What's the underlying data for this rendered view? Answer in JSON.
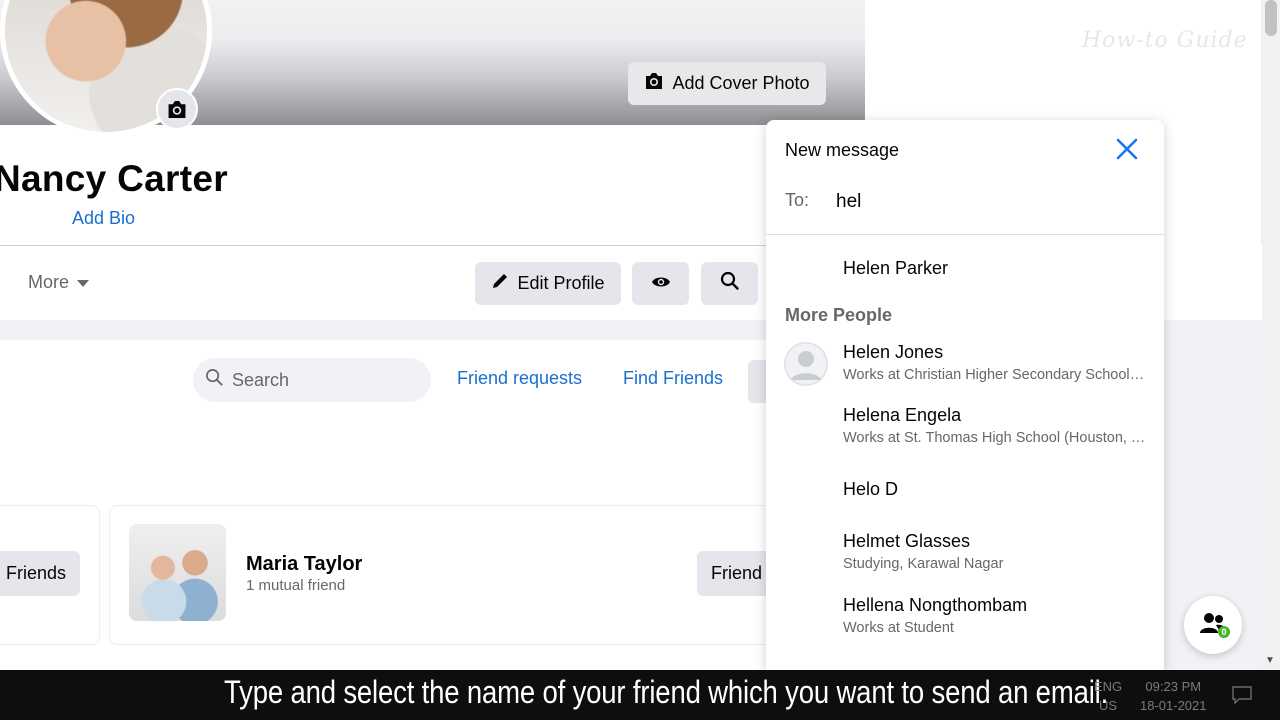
{
  "profile": {
    "name": "Nancy Carter",
    "add_bio": "Add Bio",
    "add_cover_photo": "Add Cover Photo",
    "more_tab": "More",
    "edit_profile": "Edit Profile"
  },
  "friends_section": {
    "search_placeholder": "Search",
    "friend_requests": "Friend requests",
    "find_friends": "Find Friends",
    "friend": {
      "name": "Maria Taylor",
      "mutual": "1 mutual friend",
      "button": "Friend"
    },
    "left_button": "Friends"
  },
  "watermark": "How-to Guide",
  "new_message": {
    "title": "New message",
    "to_label": "To:",
    "to_value": "hel",
    "top_result": {
      "name": "Helen Parker"
    },
    "section_label": "More People",
    "results": [
      {
        "name": "Helen Jones",
        "sub": "Works at Christian Higher Secondary School, ..."
      },
      {
        "name": "Helena Engela",
        "sub": "Works at St. Thomas High School (Houston, T..."
      },
      {
        "name": "Helo D",
        "sub": ""
      },
      {
        "name": "Helmet Glasses",
        "sub": "Studying, Karawal Nagar"
      },
      {
        "name": "Hellena Nongthombam",
        "sub": "Works at Student"
      }
    ]
  },
  "fab_badge": "0",
  "caption": "Type and select the name of your friend which you want to send an email.",
  "taskbar": {
    "lang_top": "ENG",
    "lang_bottom": "US",
    "time": "09:23 PM",
    "date": "18-01-2021"
  },
  "colors": {
    "link_blue": "#1a6fd1",
    "button_gray": "#e4e6eb",
    "text_secondary": "#65676b"
  }
}
